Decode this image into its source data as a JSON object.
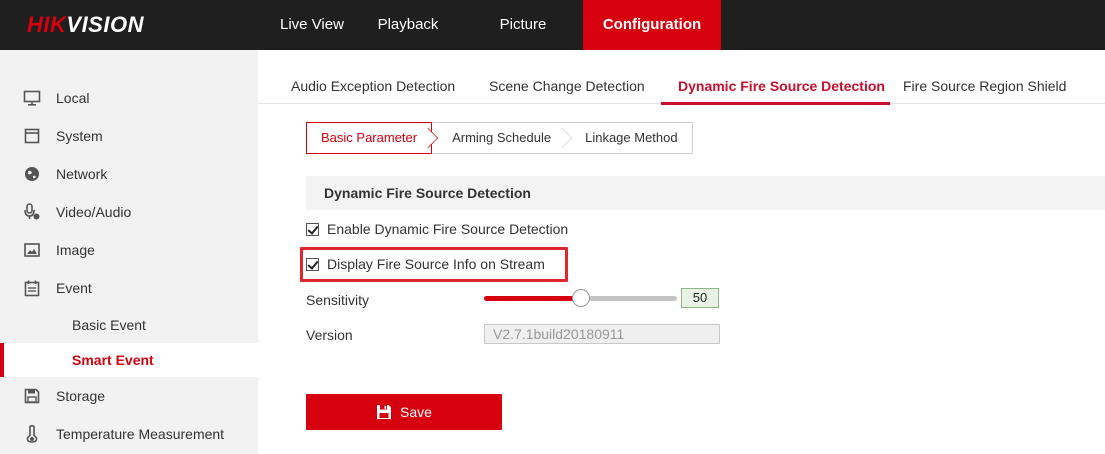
{
  "logo": {
    "part1": "HIK",
    "part2": "VISION"
  },
  "topnav": {
    "live_view": "Live View",
    "playback": "Playback",
    "picture": "Picture",
    "configuration": "Configuration"
  },
  "sidebar": {
    "items": [
      {
        "label": "Local",
        "icon": "monitor-icon"
      },
      {
        "label": "System",
        "icon": "system-icon"
      },
      {
        "label": "Network",
        "icon": "globe-icon"
      },
      {
        "label": "Video/Audio",
        "icon": "microphone-icon"
      },
      {
        "label": "Image",
        "icon": "image-icon"
      },
      {
        "label": "Event",
        "icon": "calendar-icon"
      },
      {
        "label": "Storage",
        "icon": "floppy-icon"
      },
      {
        "label": "Temperature Measurement",
        "icon": "thermometer-icon"
      }
    ],
    "sub_items": [
      {
        "label": "Basic Event"
      },
      {
        "label": "Smart Event",
        "active": true
      }
    ]
  },
  "tabs": [
    {
      "label": "Audio Exception Detection"
    },
    {
      "label": "Scene Change Detection"
    },
    {
      "label": "Dynamic Fire Source Detection",
      "active": true
    },
    {
      "label": "Fire Source Region Shield"
    }
  ],
  "subtabs": [
    {
      "label": "Basic Parameter",
      "active": true
    },
    {
      "label": "Arming Schedule"
    },
    {
      "label": "Linkage Method"
    }
  ],
  "section": {
    "title": "Dynamic Fire Source Detection"
  },
  "form": {
    "enable_label": "Enable Dynamic Fire Source Detection",
    "enable_checked": true,
    "display_info_label": "Display Fire Source Info on Stream",
    "display_info_checked": true,
    "sensitivity_label": "Sensitivity",
    "sensitivity_value": "50",
    "sensitivity_fraction": 0.5,
    "version_label": "Version",
    "version_value": "V2.7.1build20180911"
  },
  "actions": {
    "save_label": "Save"
  },
  "colors": {
    "accent": "#d7000f",
    "topbar": "#1f1f1f",
    "sidebar": "#f2f2f2"
  }
}
